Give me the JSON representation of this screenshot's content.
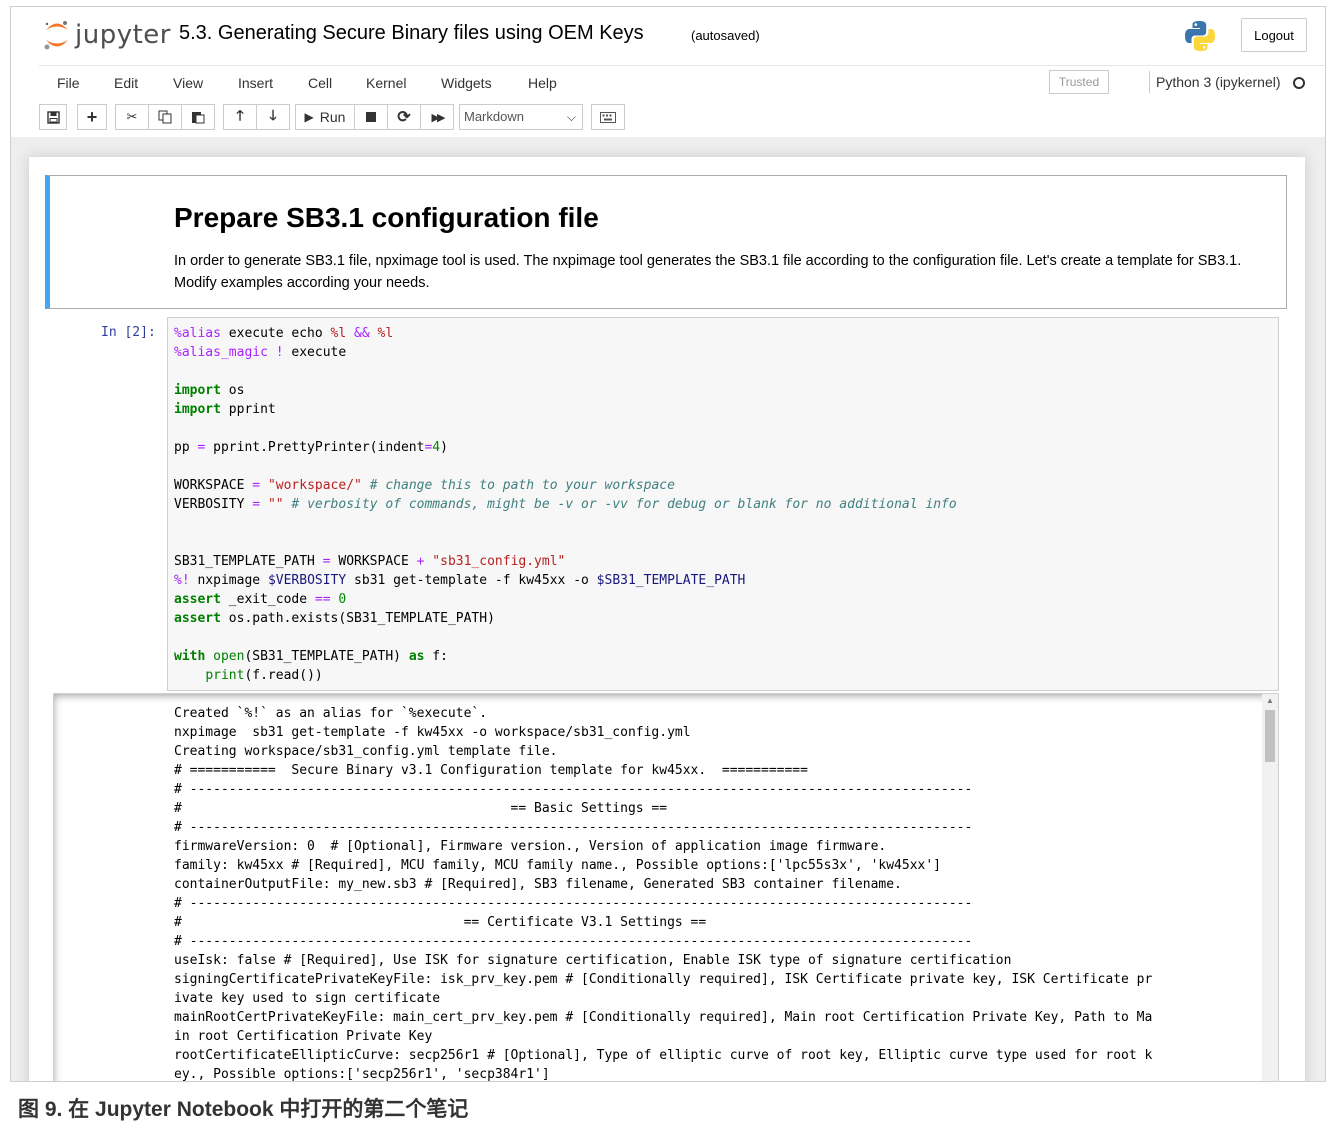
{
  "header": {
    "logo_text": "jupyter",
    "notebook_title": "5.3. Generating Secure Binary files using OEM Keys",
    "autosave_status": "(autosaved)",
    "logout_label": "Logout"
  },
  "menubar": {
    "items": [
      "File",
      "Edit",
      "View",
      "Insert",
      "Cell",
      "Kernel",
      "Widgets",
      "Help"
    ],
    "trusted_label": "Trusted",
    "kernel_name": "Python 3 (ipykernel)"
  },
  "toolbar": {
    "run_label": "Run",
    "cell_type": "Markdown"
  },
  "markdown_cell": {
    "title": "Prepare SB3.1 configuration file",
    "text": "In order to generate SB3.1 file, npximage tool is used. The nxpimage tool generates the SB3.1 file according to the configuration file. Let's create a template for SB3.1. Modify examples according your needs."
  },
  "code_cell": {
    "prompt": "In [2]:"
  },
  "output": {
    "lines": [
      "Created `%!` as an alias for `%execute`.",
      "nxpimage  sb31 get-template -f kw45xx -o workspace/sb31_config.yml",
      "Creating workspace/sb31_config.yml template file.",
      "# ===========  Secure Binary v3.1 Configuration template for kw45xx.  ===========",
      "# ----------------------------------------------------------------------------------------------------",
      "#                                          == Basic Settings ==",
      "# ----------------------------------------------------------------------------------------------------",
      "firmwareVersion: 0  # [Optional], Firmware version., Version of application image firmware.",
      "family: kw45xx # [Required], MCU family, MCU family name., Possible options:['lpc55s3x', 'kw45xx']",
      "containerOutputFile: my_new.sb3 # [Required], SB3 filename, Generated SB3 container filename.",
      "# ----------------------------------------------------------------------------------------------------",
      "#                                    == Certificate V3.1 Settings ==",
      "# ----------------------------------------------------------------------------------------------------",
      "useIsk: false # [Required], Use ISK for signature certification, Enable ISK type of signature certification",
      "signingCertificatePrivateKeyFile: isk_prv_key.pem # [Conditionally required], ISK Certificate private key, ISK Certificate pr",
      "ivate key used to sign certificate",
      "mainRootCertPrivateKeyFile: main_cert_prv_key.pem # [Conditionally required], Main root Certification Private Key, Path to Ma",
      "in root Certification Private Key",
      "rootCertificateEllipticCurve: secp256r1 # [Optional], Type of elliptic curve of root key, Elliptic curve type used for root k",
      "ey., Possible options:['secp256r1', 'secp384r1']"
    ]
  },
  "caption": "图 9.  在 Jupyter Notebook 中打开的第二个笔记",
  "colors": {
    "selected_cell_border": "#42a5f5",
    "prompt_color": "#303f9f",
    "keyword": "#008000",
    "string": "#ba2121",
    "comment": "#408080"
  }
}
